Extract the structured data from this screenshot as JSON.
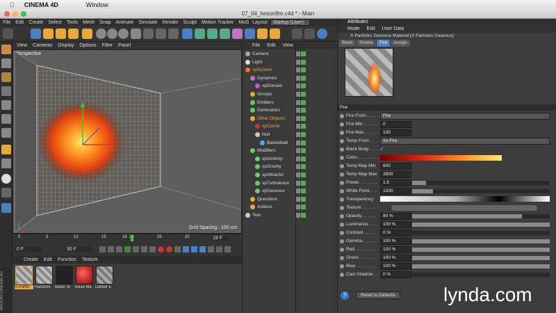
{
  "mac": {
    "app": "CINEMA 4D",
    "window_menu": "Window",
    "doc_title": "07_04_hesonfire.c4d * - Main"
  },
  "menu": [
    "File",
    "Edit",
    "Create",
    "Select",
    "Tools",
    "Mesh",
    "Snap",
    "Animate",
    "Simulate",
    "Render",
    "Sculpt",
    "Motion Tracker",
    "MoG"
  ],
  "layout": {
    "label": "Layout:",
    "value": "Startup (User)"
  },
  "viewport": {
    "menu": [
      "View",
      "Cameras",
      "Display",
      "Options",
      "Filter",
      "Panel"
    ],
    "name": "Perspective",
    "grid_spacing": "Grid Spacing : 100 cm"
  },
  "timeline": {
    "ticks": [
      "0",
      "5",
      "10",
      "15",
      "18",
      "20",
      "25",
      "30"
    ],
    "current": "18 F",
    "start": "0 F",
    "end": "30 F"
  },
  "materials": {
    "menu": [
      "Create",
      "Edit",
      "Function",
      "Texture"
    ],
    "items": [
      "X-Partic",
      "Random",
      "Black St",
      "Base Ma",
      "Darker E"
    ]
  },
  "maxon": "MAXON CINEMA 4D",
  "objects": {
    "menu": [
      "File",
      "Edit",
      "View"
    ],
    "items": [
      {
        "label": "Camera",
        "indent": 0,
        "color": "#9ab"
      },
      {
        "label": "Light",
        "indent": 0,
        "color": "#ddd"
      },
      {
        "label": "xpSystem",
        "indent": 0,
        "color": "#e87a2a"
      },
      {
        "label": "Dynamics",
        "indent": 1,
        "color": "#b7b"
      },
      {
        "label": "xpDomain",
        "indent": 2,
        "color": "#c5c"
      },
      {
        "label": "Groups",
        "indent": 1,
        "color": "#e9a83a"
      },
      {
        "label": "Emitters",
        "indent": 1,
        "color": "#6c6"
      },
      {
        "label": "Generators",
        "indent": 1,
        "color": "#6c6"
      },
      {
        "label": "Other Objects",
        "indent": 1,
        "color": "#e9a83a"
      },
      {
        "label": "xpCache",
        "indent": 2,
        "color": "#c33"
      },
      {
        "label": "Null",
        "indent": 2,
        "color": "#ccc"
      },
      {
        "label": "Basketball",
        "indent": 3,
        "color": "#5ae"
      },
      {
        "label": "Modifiers",
        "indent": 1,
        "color": "#6c6"
      },
      {
        "label": "xpVorticity",
        "indent": 2,
        "color": "#6c6"
      },
      {
        "label": "xpGravity",
        "indent": 2,
        "color": "#6c6"
      },
      {
        "label": "xpAttractor",
        "indent": 2,
        "color": "#6c6"
      },
      {
        "label": "xpTurbulence",
        "indent": 2,
        "color": "#6c6"
      },
      {
        "label": "xpGaseous",
        "indent": 2,
        "color": "#6c6"
      },
      {
        "label": "Questions",
        "indent": 1,
        "color": "#e9a83a"
      },
      {
        "label": "Actions",
        "indent": 1,
        "color": "#e9a83a"
      },
      {
        "label": "Text",
        "indent": 0,
        "color": "#ccc"
      }
    ]
  },
  "attributes": {
    "header": "Attributes",
    "menu": [
      "Mode",
      "Edit",
      "User Data"
    ],
    "title": "X-Particles Gaseous Material [X-Particles Gaseous]",
    "tabs": [
      "Basic",
      "Smoke",
      "Fire",
      "Assign"
    ],
    "active_tab": "Fire",
    "section": "Fire",
    "rows": [
      {
        "label": "Fire From . . . . . .",
        "kind": "select",
        "value": "Fire"
      },
      {
        "label": "Fire Min . . . . . .",
        "kind": "field",
        "value": "0"
      },
      {
        "label": "Fire Max . . . . . .",
        "kind": "field",
        "value": "100"
      },
      {
        "label": "Temp From . . . .",
        "kind": "select",
        "value": "As Fire"
      },
      {
        "label": "Black Body. . . . .",
        "kind": "check",
        "value": "✓"
      },
      {
        "label": "Color. . . . . . . . .",
        "kind": "gradient",
        "value": ""
      },
      {
        "label": "Temp Map Min",
        "kind": "field",
        "value": "600"
      },
      {
        "label": "Temp Map Max",
        "kind": "field",
        "value": "3500"
      },
      {
        "label": "Power. . . . . . . .",
        "kind": "slider",
        "value": "1.5",
        "fill": 0.1
      },
      {
        "label": "White Point. . . .",
        "kind": "slider",
        "value": "1500",
        "fill": 0.15
      },
      {
        "label": "Transparency",
        "kind": "bw",
        "value": ""
      },
      {
        "label": "Texture . . . . . .",
        "kind": "texture",
        "value": ""
      },
      {
        "label": "Opacity. . . . . .",
        "kind": "slider",
        "value": "80 %",
        "fill": 0.8
      },
      {
        "label": "Luminance . . . .",
        "kind": "slider",
        "value": "100 %",
        "fill": 1
      },
      {
        "label": "Contrast . . . . .",
        "kind": "slider",
        "value": "0 %",
        "fill": 0
      },
      {
        "label": "Gamma. . . . . .",
        "kind": "slider",
        "value": "100 %",
        "fill": 1
      },
      {
        "label": "Red. . . . . . . . .",
        "kind": "slider",
        "value": "100 %",
        "fill": 1
      },
      {
        "label": "Green . . . . . . .",
        "kind": "slider",
        "value": "100 %",
        "fill": 1
      },
      {
        "label": "Blue . . . . . . . .",
        "kind": "slider",
        "value": "100 %",
        "fill": 1
      },
      {
        "label": "Cast Shadow . .",
        "kind": "slider",
        "value": "0 %",
        "fill": 0
      }
    ],
    "reset": "Reset to Defaults"
  },
  "watermark": "lynda.com"
}
